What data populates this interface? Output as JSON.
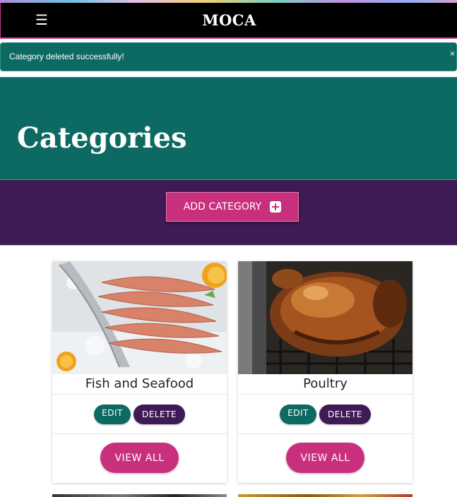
{
  "navbar": {
    "brand": "MOCA",
    "menu_icon": "hamburger-icon"
  },
  "alert": {
    "message": "Category deleted successfully!",
    "close": "×"
  },
  "hero": {
    "title": "Categories"
  },
  "actions": {
    "add_label": "ADD CATEGORY",
    "add_icon": "plus-square-icon"
  },
  "categories": [
    {
      "name": "Fish and Seafood",
      "edit": "EDIT",
      "delete": "DELETE",
      "view_all": "VIEW ALL"
    },
    {
      "name": "Poultry",
      "edit": "EDIT",
      "delete": "DELETE",
      "view_all": "VIEW ALL"
    }
  ],
  "colors": {
    "teal": "#0d6a62",
    "purple": "#3f1b55",
    "magenta": "#c8307d",
    "navbar": "#000000"
  }
}
